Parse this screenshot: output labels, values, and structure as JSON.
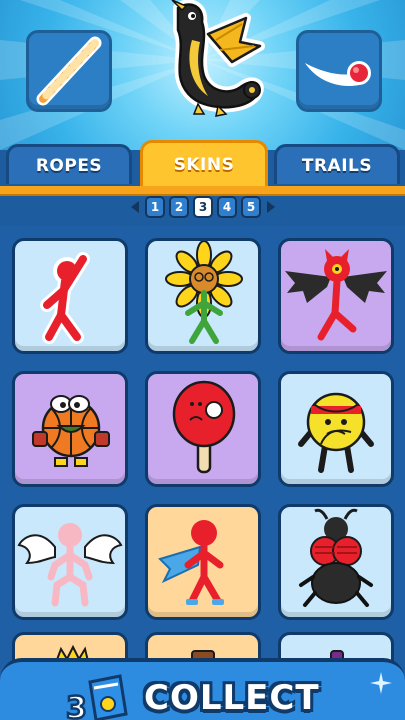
{
  "tabs": {
    "ropes": "ROPES",
    "skins": "SKINS",
    "trails": "TRAILS",
    "active": "SKINS"
  },
  "pager": {
    "pages": [
      "1",
      "2",
      "3",
      "4",
      "5"
    ],
    "current": "3"
  },
  "header": {
    "featured_skin": "dragon-icon",
    "left_item": "striped-rope-icon",
    "right_item": "ball-trail-icon"
  },
  "grid": {
    "columns": 3,
    "items": [
      {
        "icon": "red-stickman-waving-icon",
        "bg": "blue"
      },
      {
        "icon": "sunflower-stickman-icon",
        "bg": "blue"
      },
      {
        "icon": "bat-demon-stickman-icon",
        "bg": "purple"
      },
      {
        "icon": "basketball-character-icon",
        "bg": "purple"
      },
      {
        "icon": "ping-pong-paddle-icon",
        "bg": "purple"
      },
      {
        "icon": "volleyball-character-icon",
        "bg": "blue"
      },
      {
        "icon": "angel-stickman-icon",
        "bg": "blue"
      },
      {
        "icon": "superhero-stickman-icon",
        "bg": "orange"
      },
      {
        "icon": "fly-character-icon",
        "bg": "blue"
      }
    ],
    "partial_row": [
      {
        "bg": "orange"
      },
      {
        "bg": "orange"
      },
      {
        "bg": "blue"
      }
    ]
  },
  "colors": {
    "tab_active": "#ffc52e",
    "tab_inactive": "#2a6fb8",
    "card_blue": "#c9e8fb",
    "card_purple": "#c8a9ef",
    "card_orange": "#ffd79a",
    "collect_bar": "#2d8be0"
  },
  "collect": {
    "label": "COLLECT",
    "icon": "collection-book-icon"
  }
}
